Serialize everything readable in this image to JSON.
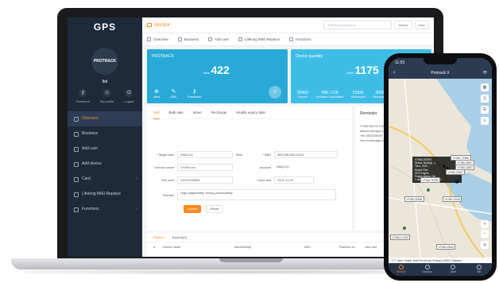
{
  "app": {
    "logo": "GPS"
  },
  "sidebar": {
    "avatar_text": "PROTRACK",
    "username": "lbd",
    "quick": [
      {
        "label": "Password",
        "icon": "key-icon"
      },
      {
        "label": "My profile",
        "icon": "user-icon"
      },
      {
        "label": "Logout",
        "icon": "logout-icon"
      }
    ],
    "menu": [
      {
        "label": "Overview",
        "icon": "overview-icon",
        "active": true
      },
      {
        "label": "Business",
        "icon": "business-icon"
      },
      {
        "label": "Add user",
        "icon": "add-user-icon"
      },
      {
        "label": "Add device",
        "icon": "add-device-icon"
      },
      {
        "label": "Card",
        "icon": "card-icon",
        "arrow": true
      },
      {
        "label": "Lifelong IMEI Replace",
        "icon": "replace-icon"
      },
      {
        "label": "Functions",
        "icon": "functions-icon",
        "arrow": true
      }
    ]
  },
  "topbar": {
    "title": "Monitor",
    "search_placeholder": "IMEI/Account/Name",
    "device_btn": "Device",
    "user_btn": "User"
  },
  "tabs": [
    "Overview",
    "Business",
    "Add user",
    "Lifelong IMEI Replace",
    "Functions"
  ],
  "card_protrack": {
    "title": "PROTRACK",
    "total_label": "Total",
    "total": "422",
    "actions": [
      {
        "label": "New",
        "icon": "new-icon"
      },
      {
        "label": "Edit",
        "icon": "edit-icon"
      },
      {
        "label": "Password",
        "icon": "password-icon"
      }
    ]
  },
  "card_device": {
    "title": "Device quantity",
    "total_label": "Total",
    "total": "1175",
    "stats": [
      {
        "value": "92463",
        "label": "Expired"
      },
      {
        "value": "998 / 218",
        "label": "Activated / Inactivated"
      },
      {
        "value": "21834",
        "label": "Recharged"
      },
      {
        "value": "3566",
        "label": "Recharged"
      }
    ]
  },
  "form": {
    "tabs": [
      "Sell",
      "Bulk sale",
      "Move",
      "Recharge",
      "Modify expiry date"
    ],
    "target_user_label": "* Target user",
    "target_user_value": "Alfa(111)",
    "new_label": "New",
    "imei_label": "* IMEI",
    "imei_value": "355728018010010",
    "device_name_label": "* Device name",
    "device_name_value": "VT065-xxx",
    "account_label": "Account",
    "account_value": "Alfa(111)",
    "sim_label": "Sim card",
    "sim_value": "13023765002",
    "user_due_label": "* User due",
    "user_due_value": "2021-12-22",
    "remark_label": "Remark",
    "remark_value": "High adaptability, strong practicability",
    "submit": "Submit",
    "reset": "Reset"
  },
  "reminder": {
    "title": "Reminder",
    "lines": [
      "VT065 968700 10000",
      "www.itrickandgps.com",
      "+86 18620198939",
      "www.itrickandgps.com"
    ]
  },
  "expired": {
    "tabs": [
      "Expired",
      "Expired(2)"
    ],
    "columns": [
      "#",
      "Device name",
      "Membership",
      "IMEI",
      "Platform ex...",
      "User due"
    ]
  },
  "phone": {
    "time": "11:53",
    "nav_title": "Protrack X",
    "popup_lines": [
      "VT065-190293",
      "Status: Moving(...)",
      "Time: 2020-...",
      "Device Extr...",
      "GPS Engine...",
      "Engine status: ON",
      "External voltage: 12.3V"
    ],
    "tags": [
      "VT065-7 E696",
      "VT065-28297",
      "VT065-18297",
      "VT065-15297",
      "VT065-7E780",
      "VT065-1E096",
      "VT065-6 1330",
      "VT065-10908",
      "VT065-15108"
    ],
    "address": "17T, Jalan Teratai, Bukit Beruntung, Selangor 48300, Malaysia",
    "tabbar": [
      "Monitor",
      "Devices",
      "Alert",
      "Me"
    ]
  }
}
